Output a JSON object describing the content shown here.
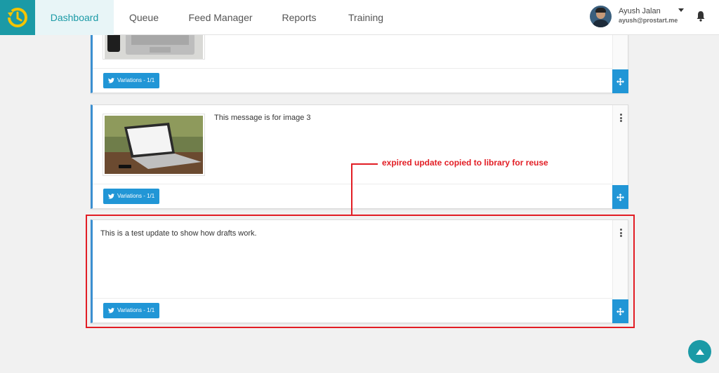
{
  "nav": {
    "items": [
      {
        "label": "Dashboard",
        "active": true
      },
      {
        "label": "Queue",
        "active": false
      },
      {
        "label": "Feed Manager",
        "active": false
      },
      {
        "label": "Reports",
        "active": false
      },
      {
        "label": "Training",
        "active": false
      }
    ],
    "logo_icon": "clock-history-icon"
  },
  "user": {
    "name": "Ayush Jalan",
    "email": "ayush@prostart.me"
  },
  "posts": [
    {
      "message": "",
      "has_image": true,
      "image": "laptop-desk-topdown",
      "variations_label": "Variations - 1/1"
    },
    {
      "message": "This message is for image 3",
      "has_image": true,
      "image": "laptop-google-outdoor",
      "variations_label": "Variations - 1/1"
    },
    {
      "message": "This is a test update to show how drafts work.",
      "has_image": false,
      "variations_label": "Variations - 1/1"
    }
  ],
  "annotation": {
    "text": "expired update copied to library for reuse",
    "color": "#e21d24"
  },
  "colors": {
    "brand": "#1b9aa6",
    "button": "#2196d6"
  }
}
